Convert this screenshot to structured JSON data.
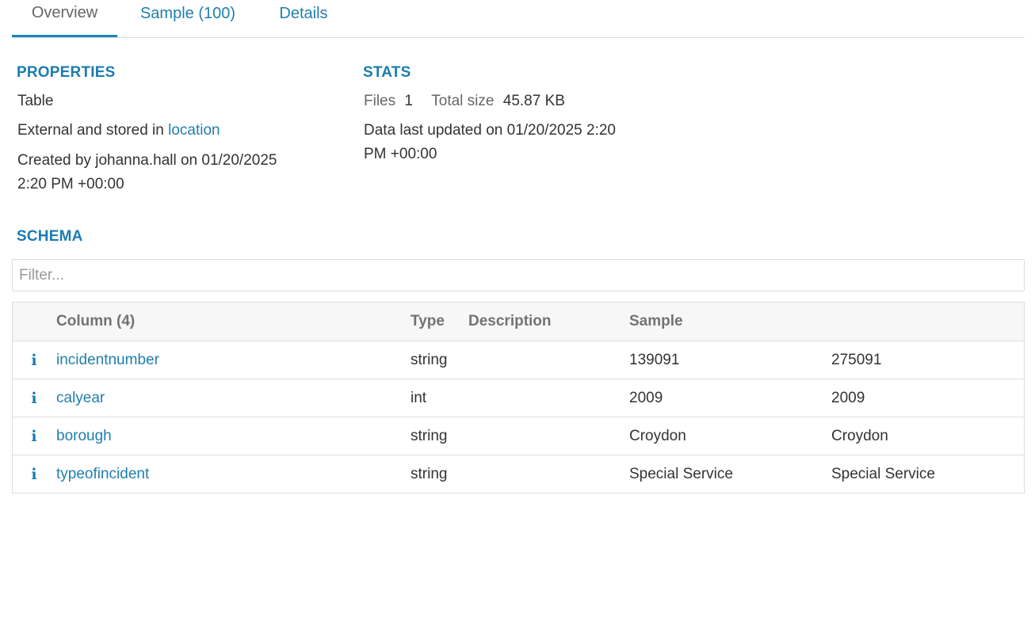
{
  "tabs": [
    {
      "label": "Overview",
      "active": true
    },
    {
      "label": "Sample (100)",
      "active": false
    },
    {
      "label": "Details",
      "active": false
    }
  ],
  "properties": {
    "heading": "PROPERTIES",
    "table_type": "Table",
    "storage_prefix": "External and stored in",
    "storage_link": "location",
    "created_line1": "Created by johanna.hall on 01/20/2025",
    "created_line2": "2:20 PM +00:00"
  },
  "stats": {
    "heading": "STATS",
    "files_label": "Files",
    "files_value": "1",
    "size_label": "Total size",
    "size_value": "45.87 KB",
    "updated_line1": "Data last updated on 01/20/2025 2:20",
    "updated_line2": "PM +00:00"
  },
  "schema": {
    "heading": "SCHEMA",
    "filter_placeholder": "Filter...",
    "columns_header": {
      "name": "Column (4)",
      "type": "Type",
      "description": "Description",
      "sample": "Sample"
    },
    "rows": [
      {
        "icon": "info-icon",
        "name": "incidentnumber",
        "type": "string",
        "description": "",
        "sample1": "139091",
        "sample2": "275091"
      },
      {
        "icon": "info-icon",
        "name": "calyear",
        "type": "int",
        "description": "",
        "sample1": "2009",
        "sample2": "2009"
      },
      {
        "icon": "info-icon",
        "name": "borough",
        "type": "string",
        "description": "",
        "sample1": "Croydon",
        "sample2": "Croydon"
      },
      {
        "icon": "info-icon",
        "name": "typeofincident",
        "type": "string",
        "description": "",
        "sample1": "Special Service",
        "sample2": "Special Service"
      }
    ]
  },
  "colors": {
    "accent": "#1a7db0",
    "link": "#1f7fae",
    "border": "#dddddd",
    "header_bg": "#f7f7f7"
  }
}
